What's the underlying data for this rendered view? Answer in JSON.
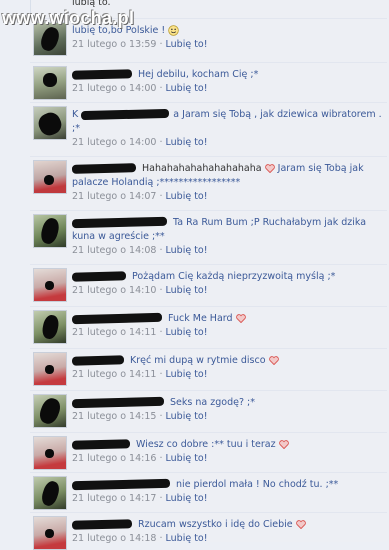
{
  "watermark": {
    "text": "www.wiocha.pl"
  },
  "top_snippet": "lubią to.",
  "comments": [
    {
      "message": "lubię to,bo Polskie !",
      "time": "21 lutego o 13:59",
      "like": "Lubię to!",
      "emoji": "smile"
    },
    {
      "message": "Hej debilu, kocham Cię ;*",
      "time": "21 lutego o 14:00",
      "like": "Lubię to!"
    },
    {
      "author_fragment": "K",
      "message": "a Jaram się Tobą , jak dziewica wibratorem . ;*",
      "time": "21 lutego o 14:00",
      "like": "Lubię to!"
    },
    {
      "message": "Hahahahahahahahahaha",
      "message2": "Jaram się Tobą jak palacze Holandią ;*****************",
      "time": "21 lutego o 14:07",
      "like": "Lubię to!",
      "emoji": "heart"
    },
    {
      "message": "Ta Ra Rum Bum ;P Ruchałabym jak dzika kuna w agreście ;**",
      "time": "21 lutego o 14:08",
      "like": "Lubię to!"
    },
    {
      "message": "Pożądam Cię każdą nieprzyzwoitą myślą ;*",
      "time": "21 lutego o 14:10",
      "like": "Lubię to!"
    },
    {
      "message": "Fuck Me Hard",
      "time": "21 lutego o 14:11",
      "like": "Lubię to!",
      "emoji": "heart"
    },
    {
      "message": "Kręć mi dupą w rytmie disco",
      "time": "21 lutego o 14:11",
      "like": "Lubię to!",
      "emoji": "heart"
    },
    {
      "message": "Seks na zgodę? ;*",
      "time": "21 lutego o 14:15",
      "like": "Lubię to!"
    },
    {
      "message": "Wiesz co dobre :** tuu i teraz",
      "time": "21 lutego o 14:16",
      "like": "Lubię to!",
      "emoji": "heart"
    },
    {
      "message": "nie pierdol mała ! No chodź tu. ;**",
      "time": "21 lutego o 14:17",
      "like": "Lubię to!"
    },
    {
      "message": "Rzucam wszystko i idę do Ciebie",
      "time": "21 lutego o 14:18",
      "like": "Lubię to!",
      "emoji": "heart"
    }
  ],
  "separator": "·",
  "colors": {
    "link": "#3b5998",
    "meta": "#8b8f98",
    "background": "#edeff4",
    "heart": "#d9534f"
  }
}
